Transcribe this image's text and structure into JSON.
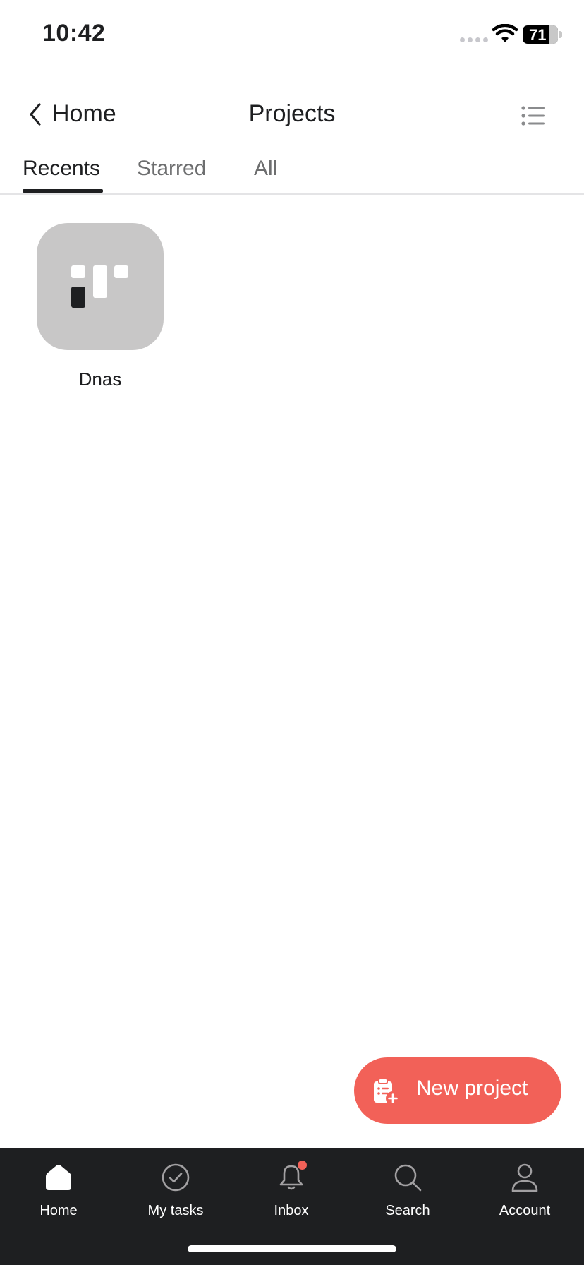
{
  "status_bar": {
    "time": "10:42",
    "battery": "71"
  },
  "header": {
    "back_label": "Home",
    "title": "Projects"
  },
  "tabs": [
    {
      "label": "Recents",
      "active": true
    },
    {
      "label": "Starred",
      "active": false
    },
    {
      "label": "All",
      "active": false
    }
  ],
  "projects": [
    {
      "name": "Dnas",
      "icon": "board-icon"
    }
  ],
  "fab": {
    "label": "New project",
    "icon": "clipboard-plus-icon"
  },
  "bottom_nav": [
    {
      "label": "Home",
      "icon": "home-icon",
      "active": true
    },
    {
      "label": "My tasks",
      "icon": "check-circle-icon"
    },
    {
      "label": "Inbox",
      "icon": "bell-icon",
      "badge": true
    },
    {
      "label": "Search",
      "icon": "search-icon"
    },
    {
      "label": "Account",
      "icon": "person-icon"
    }
  ],
  "colors": {
    "accent": "#f26158",
    "nav_bg": "#1e1f21",
    "tile_bg": "#c8c7c7",
    "text": "#1e1f21",
    "muted": "#6d6e6f"
  }
}
